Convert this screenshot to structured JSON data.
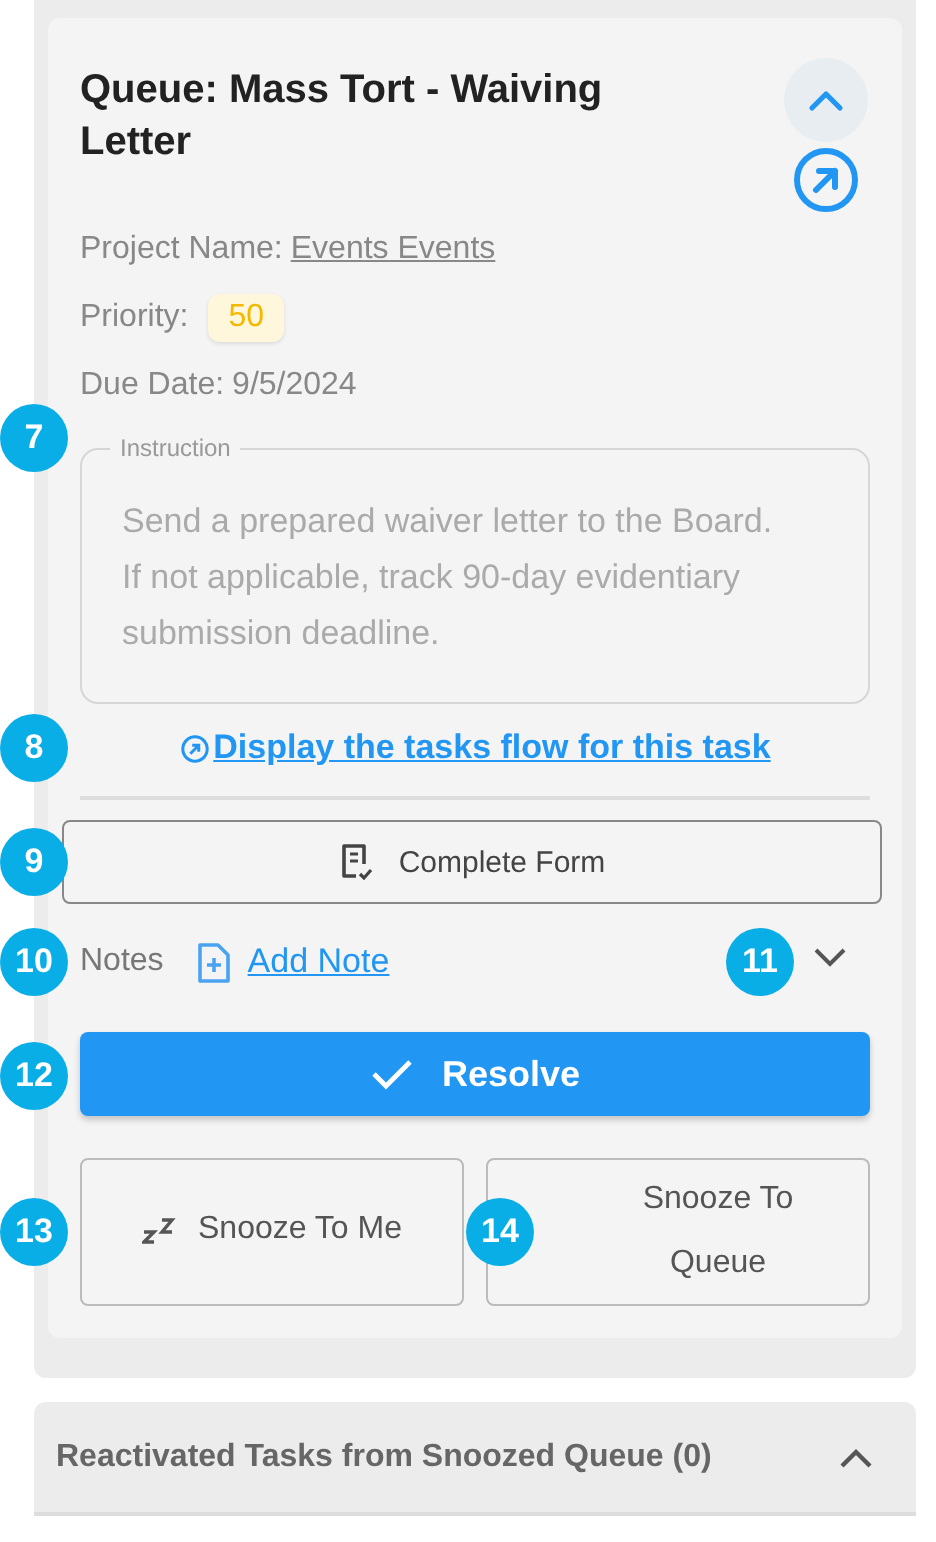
{
  "task": {
    "title": "Queue: Mass Tort - Waiving Letter",
    "expanded": true,
    "project_label": "Project Name:",
    "project_name": "Events Events",
    "priority_label": "Priority:",
    "priority": "50",
    "due_label": "Due Date:",
    "due_date": "9/5/2024"
  },
  "instruction": {
    "legend": "Instruction",
    "text": "Send a prepared waiver letter to the Board. If not applicable,  track 90-day evidentiary submission deadline.",
    "callout": "7"
  },
  "flow_link": {
    "text": "Display the tasks flow for this task",
    "callout": "8"
  },
  "complete_form": {
    "label": "Complete Form",
    "callout": "9"
  },
  "notes": {
    "label": "Notes",
    "add_label": "Add Note",
    "expanded": false,
    "callout": "10",
    "toggle_callout": "11"
  },
  "resolve": {
    "label": "Resolve",
    "callout": "12"
  },
  "snooze": [
    {
      "kind": "me",
      "label": "Snooze To Me",
      "callout": "13"
    },
    {
      "kind": "queue",
      "label": "Snooze To Queue",
      "callout": "14"
    }
  ],
  "reactivated": {
    "title": "Reactivated Tasks from Snoozed Queue (0)",
    "expanded": true
  }
}
